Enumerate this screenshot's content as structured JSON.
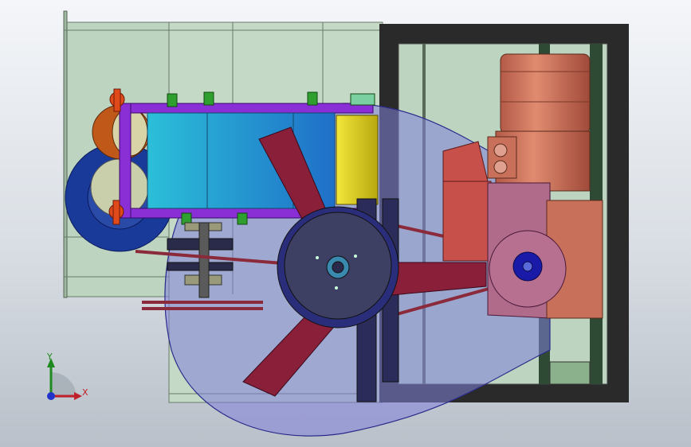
{
  "viewport": {
    "background_top": "#f4f6f9",
    "background_bottom": "#b9c0c9"
  },
  "colors": {
    "frame_panel": "#bcd4c0",
    "black_frame": "#2a2a2a",
    "motor_body": "#c8705a",
    "gearbox": "#b05a5a",
    "fan_blade": "#8a1f3a",
    "fan_hub": "#3d3f63",
    "belt_guard": "#7f80d8",
    "carriage_purple": "#8a2fd6",
    "cyan_block": "#2fbfd6",
    "yellow_drum": "#e6d820",
    "blue_pulley": "#1a3a9a",
    "handwheel": "#e04a1a",
    "green_clamp": "#2fa02f"
  },
  "triad": {
    "x_label": "X",
    "y_label": "Y",
    "x_color": "#c0202a",
    "y_color": "#1f8a1f",
    "z_color": "#2233cc"
  }
}
